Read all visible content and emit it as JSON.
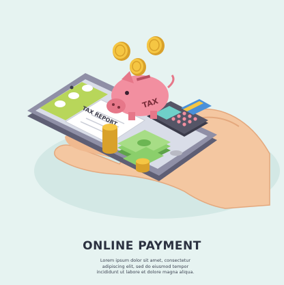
{
  "illustration": {
    "title": "ONLINE PAYMENT",
    "description_lines": [
      "Lorem ipsum dolor sit amet, consectetur",
      "adipiscing elit, sed do eiusmod tempor",
      "incididunt ut labore et dolore magna aliqua."
    ],
    "receipt_heading": "TAX REPORT",
    "piggy_bank_label": "TAX",
    "colors": {
      "background": "#e6f3f1",
      "hand": "#f4c7a1",
      "phone_body": "#8f8fa6",
      "piggy_bank": "#f28fa0",
      "coin": "#f5c643",
      "cash": "#8bcf6b",
      "title_text": "#2b3140"
    }
  }
}
